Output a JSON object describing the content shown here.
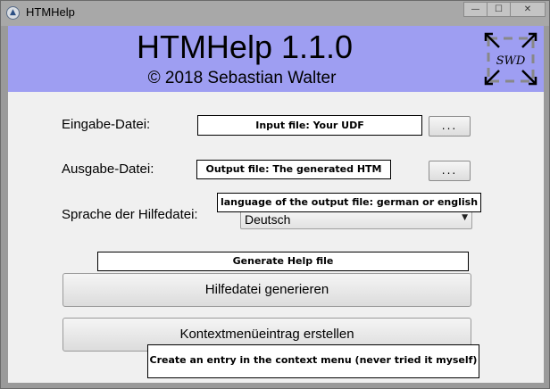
{
  "window": {
    "title": "HTMHelp",
    "controls": {
      "minimize": "—",
      "maximize": "☐",
      "close": "✕"
    }
  },
  "header": {
    "title": "HTMHelp 1.1.0",
    "copyright": "© 2018 Sebastian Walter",
    "logo_text": "SWD",
    "background": "#9e9ef2"
  },
  "form": {
    "input_label": "Eingabe-Datei:",
    "input_tip": "Input file: Your UDF",
    "input_browse": "...",
    "output_label": "Ausgabe-Datei:",
    "output_tip": "Output file: The generated HTM",
    "output_browse": "...",
    "language_label": "Sprache der Hilfedatei:",
    "language_tip": "language of the output file: german or english",
    "language_value": "Deutsch"
  },
  "actions": {
    "generate_tip": "Generate Help file",
    "generate_label": "Hilfedatei generieren",
    "context_label": "Kontextmenüeintrag erstellen",
    "context_tip": "Create an entry in the context menu (never tried it myself)"
  }
}
